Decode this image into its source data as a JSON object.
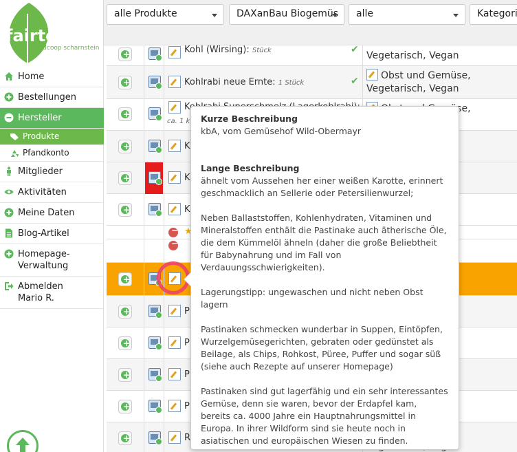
{
  "logo": {
    "brand": "fairteiler",
    "subtitle": "foodcoop scharnstein",
    "colors": {
      "leaf": "#6cb84a",
      "text": "#ffffff"
    }
  },
  "nav": {
    "items": [
      {
        "label": "Home",
        "icon": "home-icon"
      },
      {
        "label": "Bestellungen",
        "icon": "plus-circle-icon"
      },
      {
        "label": "Hersteller",
        "icon": "minus-circle-icon",
        "active": true
      },
      {
        "label": "Mitglieder",
        "icon": "person-icon"
      },
      {
        "label": "Aktivitäten",
        "icon": "eye-icon"
      },
      {
        "label": "Meine Daten",
        "icon": "plus-circle-icon"
      },
      {
        "label": "Blog-Artikel",
        "icon": "document-icon"
      },
      {
        "label": "Homepage-Verwaltung",
        "icon": "plus-circle-icon"
      },
      {
        "label": "Abmelden Mario R.",
        "icon": "sign-out-icon"
      }
    ],
    "subitems": [
      {
        "label": "Produkte",
        "icon": "tags-icon",
        "active": true
      },
      {
        "label": "Pfandkonto",
        "icon": "recycle-icon"
      }
    ],
    "labels": {
      "home": "Home",
      "bestellungen": "Bestellungen",
      "hersteller": "Hersteller",
      "produkte": "Produkte",
      "pfandkonto": "Pfandkonto",
      "mitglieder": "Mitglieder",
      "aktivitaeten": "Aktivitäten",
      "meine_daten": "Meine Daten",
      "blog": "Blog-Artikel",
      "homepage_1": "Homepage-",
      "homepage_2": "Verwaltung",
      "abmelden_1": "Abmelden",
      "abmelden_2": "Mario R."
    },
    "accent": "#5cb85c"
  },
  "filters": {
    "products": "alle Produkte",
    "manufacturer": "DAXanBau Biogemüs",
    "status": "alle",
    "category": "Kategori"
  },
  "rows": [
    {
      "name": "Kohl (Wirsing):",
      "unit": "Stück",
      "cat1": "Vegetarisch, Vegan"
    },
    {
      "name": "Kohlrabi neue Ernte:",
      "unit": "1 Stück",
      "cat1": "Obst und Gemüse,",
      "cat2": "Vegetarisch, Vegan"
    },
    {
      "name": "Kohlrabi Superschmelz (Lagerkohlrabi):",
      "unit": "ca. 1 k",
      "cat1": "Obst und Gemüse,"
    },
    {
      "name": "K"
    },
    {
      "name": "K"
    },
    {
      "name": "K"
    },
    {
      "name": ""
    },
    {
      "name": "P"
    },
    {
      "name": "P"
    },
    {
      "name": "P"
    },
    {
      "name": "P"
    },
    {
      "name": "R"
    },
    {
      "name": "R",
      "cat_bottom": "Vegetarisch, Vegan"
    }
  ],
  "tooltip": {
    "short_title": "Kurze Beschreibung",
    "short_text": "kbA, vom Gemüsehof Wild-Obermayr",
    "long_title": "Lange Beschreibung",
    "p1": "ähnelt vom Aussehen her einer weißen Karotte, erinnert geschmacklich an Sellerie oder Petersilienwurzel;",
    "p2": "Neben Ballaststoffen, Kohlenhydraten, Vitaminen und Mineralstoffen enthält die Pastinake auch ätherische Öle, die dem Kümmelöl ähneln (daher die große Beliebtheit für Babynahrung und im Fall von Verdauungsschwierigkeiten).",
    "p3": "Lagerungstipp: ungewaschen und nicht neben Obst lagern",
    "p4": "Pastinaken schmecken wunderbar in Suppen, Eintöpfen, Wurzelgemüsegerichten, gebraten oder gedünstet als Beilage, als Chips, Rohkost, Püree, Puffer und sogar süß (siehe auch Rezepte auf unserer Homepage)",
    "p5": "Pastinaken sind gut lagerfähig und ein sehr interessantes Gemüse, denn sie waren, bevor der Erdapfel kam, bereits ca. 4000 Jahre ein Hauptnahrungsmittel in Europa. In ihrer Wildform sind sie heute noch in asiatischen und europäischen Wiesen zu finden."
  },
  "colors": {
    "highlight_row": "#f9a300",
    "red_cell": "#e61c1c",
    "annotation_circle": "#ee4466"
  }
}
